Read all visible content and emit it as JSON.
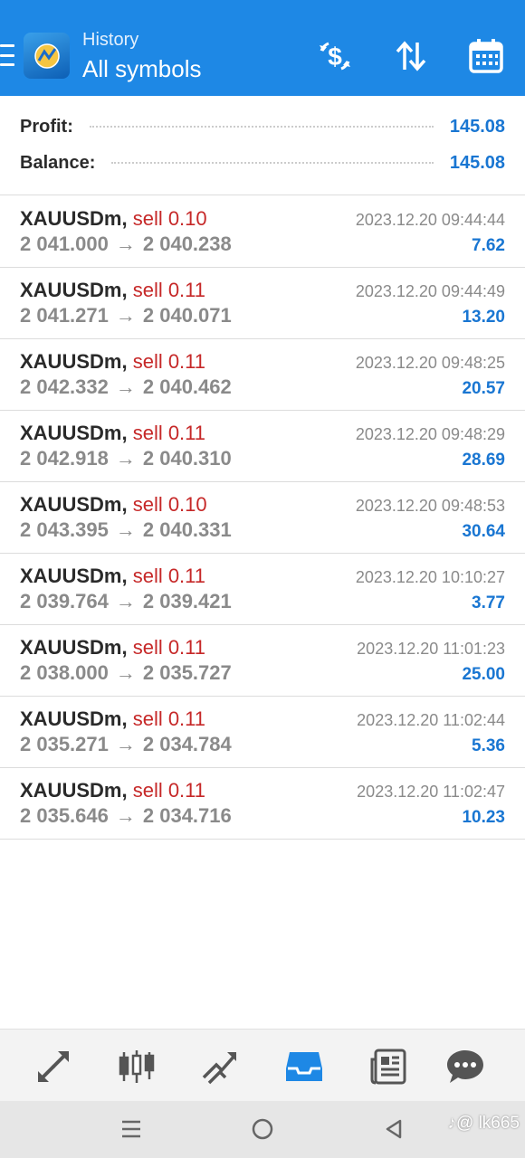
{
  "header": {
    "title": "History",
    "subtitle": "All symbols",
    "colors": {
      "accent": "#1e88e5"
    },
    "icons": [
      "menu-icon",
      "app-logo-icon",
      "deposit-withdraw-icon",
      "sort-icon",
      "calendar-icon"
    ]
  },
  "summary": {
    "profit_label": "Profit:",
    "profit_value": "145.08",
    "balance_label": "Balance:",
    "balance_value": "145.08"
  },
  "deals": [
    {
      "symbol": "XAUUSDm,",
      "side": "sell 0.10",
      "open": "2 041.000",
      "close": "2 040.238",
      "time": "2023.12.20 09:44:44",
      "profit": "7.62"
    },
    {
      "symbol": "XAUUSDm,",
      "side": "sell 0.11",
      "open": "2 041.271",
      "close": "2 040.071",
      "time": "2023.12.20 09:44:49",
      "profit": "13.20"
    },
    {
      "symbol": "XAUUSDm,",
      "side": "sell 0.11",
      "open": "2 042.332",
      "close": "2 040.462",
      "time": "2023.12.20 09:48:25",
      "profit": "20.57"
    },
    {
      "symbol": "XAUUSDm,",
      "side": "sell 0.11",
      "open": "2 042.918",
      "close": "2 040.310",
      "time": "2023.12.20 09:48:29",
      "profit": "28.69"
    },
    {
      "symbol": "XAUUSDm,",
      "side": "sell 0.10",
      "open": "2 043.395",
      "close": "2 040.331",
      "time": "2023.12.20 09:48:53",
      "profit": "30.64"
    },
    {
      "symbol": "XAUUSDm,",
      "side": "sell 0.11",
      "open": "2 039.764",
      "close": "2 039.421",
      "time": "2023.12.20 10:10:27",
      "profit": "3.77"
    },
    {
      "symbol": "XAUUSDm,",
      "side": "sell 0.11",
      "open": "2 038.000",
      "close": "2 035.727",
      "time": "2023.12.20 11:01:23",
      "profit": "25.00"
    },
    {
      "symbol": "XAUUSDm,",
      "side": "sell 0.11",
      "open": "2 035.271",
      "close": "2 034.784",
      "time": "2023.12.20 11:02:44",
      "profit": "5.36"
    },
    {
      "symbol": "XAUUSDm,",
      "side": "sell 0.11",
      "open": "2 035.646",
      "close": "2 034.716",
      "time": "2023.12.20 11:02:47",
      "profit": "10.23"
    }
  ],
  "deal_arrow": "→",
  "bottom_nav": {
    "items": [
      "quotes-icon",
      "chart-icon",
      "trade-icon",
      "history-icon",
      "news-icon",
      "chat-icon"
    ],
    "active": "history-icon"
  },
  "watermark": "♪@ lk665"
}
